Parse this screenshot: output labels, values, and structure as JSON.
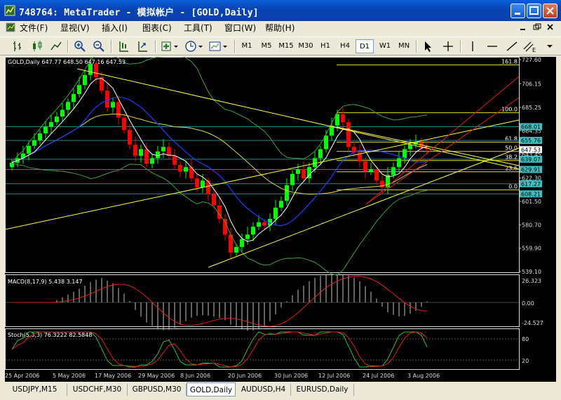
{
  "window": {
    "title": "748764: MetaTrader - 模拟帐户 - [GOLD,Daily]"
  },
  "menu": {
    "items": [
      "文件(F)",
      "显视(V)",
      "插入(I)",
      "图表(C)",
      "工具(T)",
      "窗口(W)",
      "帮助(H)"
    ]
  },
  "toolbar": {
    "timeframes": [
      "M1",
      "M5",
      "M15",
      "M30",
      "H1",
      "H4",
      "D1",
      "W1",
      "MN"
    ],
    "active_timeframe": "D1"
  },
  "chart": {
    "header": "GOLD,Daily  647.77 648.50 647.16 647.53",
    "price_labels": [
      "727.60",
      "706.15",
      "685.25",
      "664.35",
      "643.45",
      "622.30",
      "601.50",
      "580.70",
      "559.90",
      "539.10"
    ],
    "fib_levels": [
      {
        "label": "161.8",
        "price": "722.9"
      },
      {
        "label": "100.0",
        "price": "680.4"
      },
      {
        "label": "61.8",
        "price": "654.2"
      },
      {
        "label": "50.0",
        "price": "646.0"
      },
      {
        "label": "38.2",
        "price": "637.9"
      },
      {
        "label": "23.6",
        "price": "627.9"
      },
      {
        "label": "0.0",
        "price": "611.7"
      }
    ],
    "price_tags": [
      {
        "text": "668.01",
        "color": "#3fbfbf"
      },
      {
        "text": "655.76",
        "color": "#3fbfbf"
      },
      {
        "text": "647.53",
        "color": "#ffffff"
      },
      {
        "text": "639.07",
        "color": "#3fbfbf"
      },
      {
        "text": "629.91",
        "color": "#3fbfbf"
      },
      {
        "text": "617.27",
        "color": "#3fbfbf"
      },
      {
        "text": "608.21",
        "color": "#3fbfbf"
      }
    ],
    "dates": [
      "25 Apr 2006",
      "5 May 2006",
      "17 May 2006",
      "29 May 2006",
      "8 Jun 2006",
      "20 Jun 2006",
      "30 Jun 2006",
      "12 Jul 2006",
      "24 Jul 2006",
      "3 Aug 2006"
    ],
    "macd": {
      "header": "MACD(8,17,9) 5.438 3.147",
      "scale": [
        "26.323",
        "0.00",
        "-24.527"
      ]
    },
    "stoch": {
      "header": "Stoch(5,3,3) 76.3222 82.5848",
      "scale": [
        "80",
        "20"
      ]
    },
    "colors": {
      "bull": "#00ff00",
      "bear": "#ff0000",
      "ma_fast": "#ffffff",
      "ma_slow": "#1e3cff",
      "bands": "#3fa03f",
      "trend": "#ffff40",
      "fib": "#e0e020"
    }
  },
  "chart_data": {
    "type": "candlestick",
    "title": "GOLD,Daily",
    "x_labels": [
      "25 Apr 2006",
      "5 May 2006",
      "17 May 2006",
      "29 May 2006",
      "8 Jun 2006",
      "20 Jun 2006",
      "30 Jun 2006",
      "12 Jul 2006",
      "24 Jul 2006",
      "3 Aug 2006"
    ],
    "ylim": [
      539.1,
      727.6
    ],
    "close": [
      636,
      640,
      644,
      651,
      656,
      662,
      668,
      672,
      677,
      683,
      690,
      697,
      705,
      714,
      724,
      712,
      700,
      685,
      690,
      676,
      665,
      652,
      642,
      648,
      635,
      640,
      646,
      650,
      642,
      634,
      628,
      632,
      622,
      614,
      620,
      608,
      598,
      586,
      572,
      556,
      561,
      568,
      572,
      579,
      583,
      580,
      586,
      596,
      602,
      616,
      626,
      630,
      622,
      632,
      640,
      648,
      660,
      669,
      679,
      672,
      650,
      645,
      637,
      628,
      630,
      620,
      614,
      625,
      632,
      640,
      648,
      652,
      654,
      650,
      648
    ],
    "last": {
      "open": 647.77,
      "high": 648.5,
      "low": 647.16,
      "close": 647.53
    }
  },
  "tabs": {
    "items": [
      "USDJPY,M15",
      "USDCHF,M30",
      "GBPUSD,M30",
      "GOLD,Daily",
      "AUDUSD,H4",
      "EURUSD,Daily"
    ],
    "active": "GOLD,Daily"
  }
}
